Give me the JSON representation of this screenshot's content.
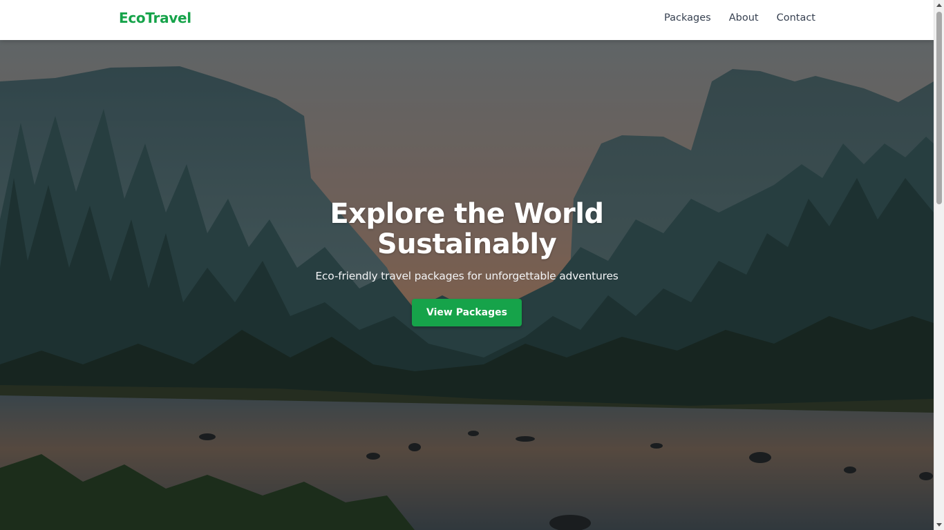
{
  "header": {
    "logo": "EcoTravel",
    "nav": [
      {
        "label": "Packages"
      },
      {
        "label": "About"
      },
      {
        "label": "Contact"
      }
    ]
  },
  "hero": {
    "title": "Explore the World Sustainably",
    "subtitle": "Eco-friendly travel packages for unforgettable adventures",
    "cta_label": "View Packages",
    "background_image": "mountain-valley-forest-river-photo"
  },
  "colors": {
    "brand_green": "#16a34a",
    "nav_text": "#374151",
    "header_bg": "#ffffff"
  }
}
